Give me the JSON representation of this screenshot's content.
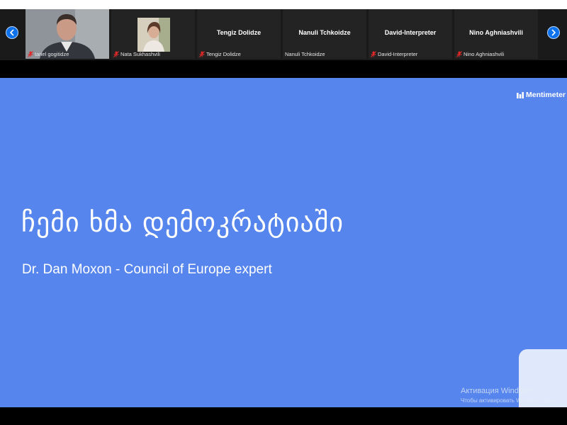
{
  "participants": [
    {
      "display_name": "",
      "label": "tariel gogitidze",
      "has_video": true
    },
    {
      "display_name": "",
      "label": "Nata Sukhashvili",
      "has_video": true
    },
    {
      "display_name": "Tengiz Dolidze",
      "label": "Tengiz Dolidze",
      "has_video": false
    },
    {
      "display_name": "Nanuli Tchkoidze",
      "label": "Nanuli Tchkoidze",
      "has_video": false
    },
    {
      "display_name": "David-Interpreter",
      "label": "David-Interpreter",
      "has_video": false
    },
    {
      "display_name": "Nino Aghniashvili",
      "label": "Nino Aghniashvili",
      "has_video": false
    }
  ],
  "nav": {
    "prev_icon": "chevron-left-icon",
    "next_icon": "chevron-right-icon"
  },
  "slide": {
    "brand": "Mentimeter",
    "title": "ჩემი ხმა დემოკრატიაში",
    "subtitle": "Dr. Dan Moxon - Council of Europe expert",
    "background": "#5685ee"
  },
  "watermark": {
    "title": "Активация Windows",
    "subtitle": "Чтобы активировать Windows, перей"
  },
  "colors": {
    "accent": "#0e72ed",
    "muted_mic": "#e02828"
  }
}
